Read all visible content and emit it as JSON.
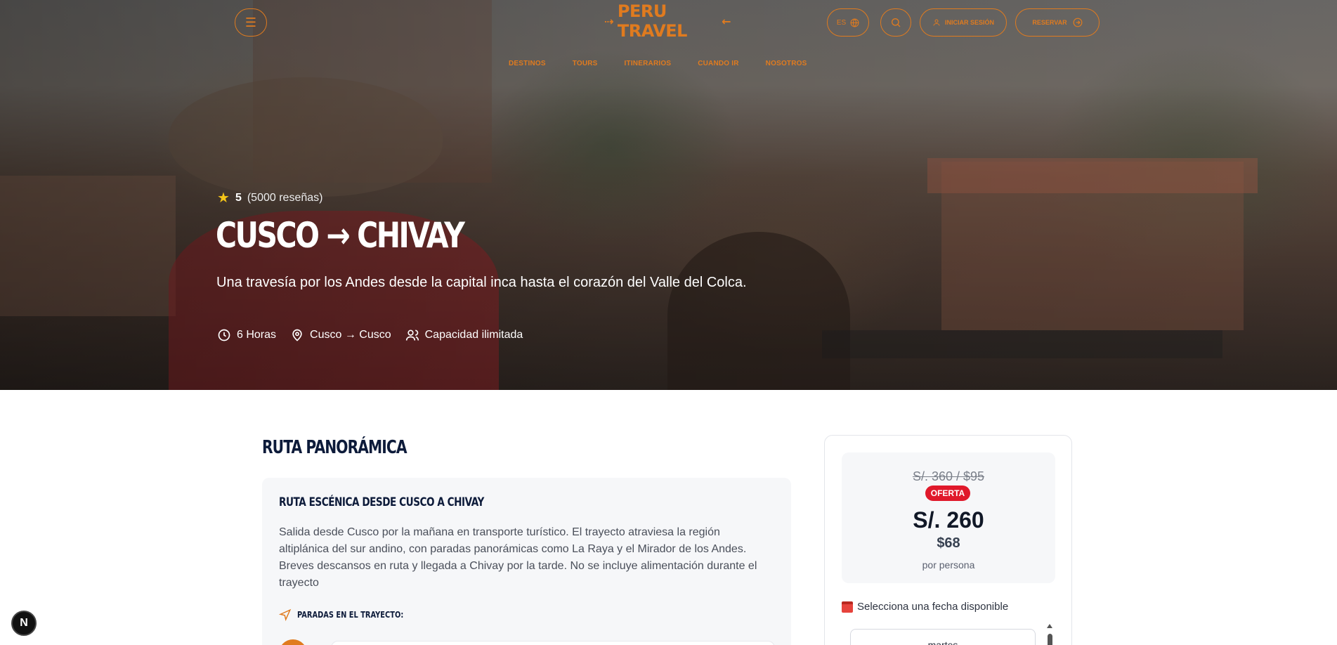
{
  "header": {
    "logo": "PERU TRAVEL",
    "lang": "ES",
    "login_label": "Iniciar sesión",
    "reserve_label": "Reservar",
    "nav": [
      "Destinos",
      "Tours",
      "Itinerarios",
      "Cuando ir",
      "Nosotros"
    ]
  },
  "hero": {
    "rating": "5",
    "reviews": "(5000 reseñas)",
    "title": "CUSCO → CHIVAY",
    "subtitle": "Una travesía por los Andes desde la capital inca hasta el corazón del Valle del Colca.",
    "duration": "6 Horas",
    "route": "Cusco → Cusco",
    "capacity": "Capacidad ilimitada"
  },
  "content": {
    "section_title": "RUTA PANORÁMICA",
    "card_title": "RUTA ESCÉNICA DESDE CUSCO A CHIVAY",
    "card_text": "Salida desde Cusco por la mañana en transporte turístico. El trayecto atraviesa la región altiplánica del sur andino, con paradas panorámicas como La Raya y el Mirador de los Andes. Breves descansos en ruta y llegada a Chivay por la tarde. No se incluye alimentación durante el trayecto",
    "stops_label": "PARADAS EN EL TRAYECTO:"
  },
  "booking": {
    "old_price": "S/. 360 / $95",
    "badge": "OFERTA",
    "price": "S/. 260",
    "price_usd": "$68",
    "per_person": "por persona",
    "date_label": "Selecciona una fecha disponible",
    "date_value": "martes"
  },
  "dev": {
    "badge": "N"
  },
  "colors": {
    "accent": "#e07b1f",
    "offer": "#e0192b",
    "navy": "#0d1b3a"
  }
}
